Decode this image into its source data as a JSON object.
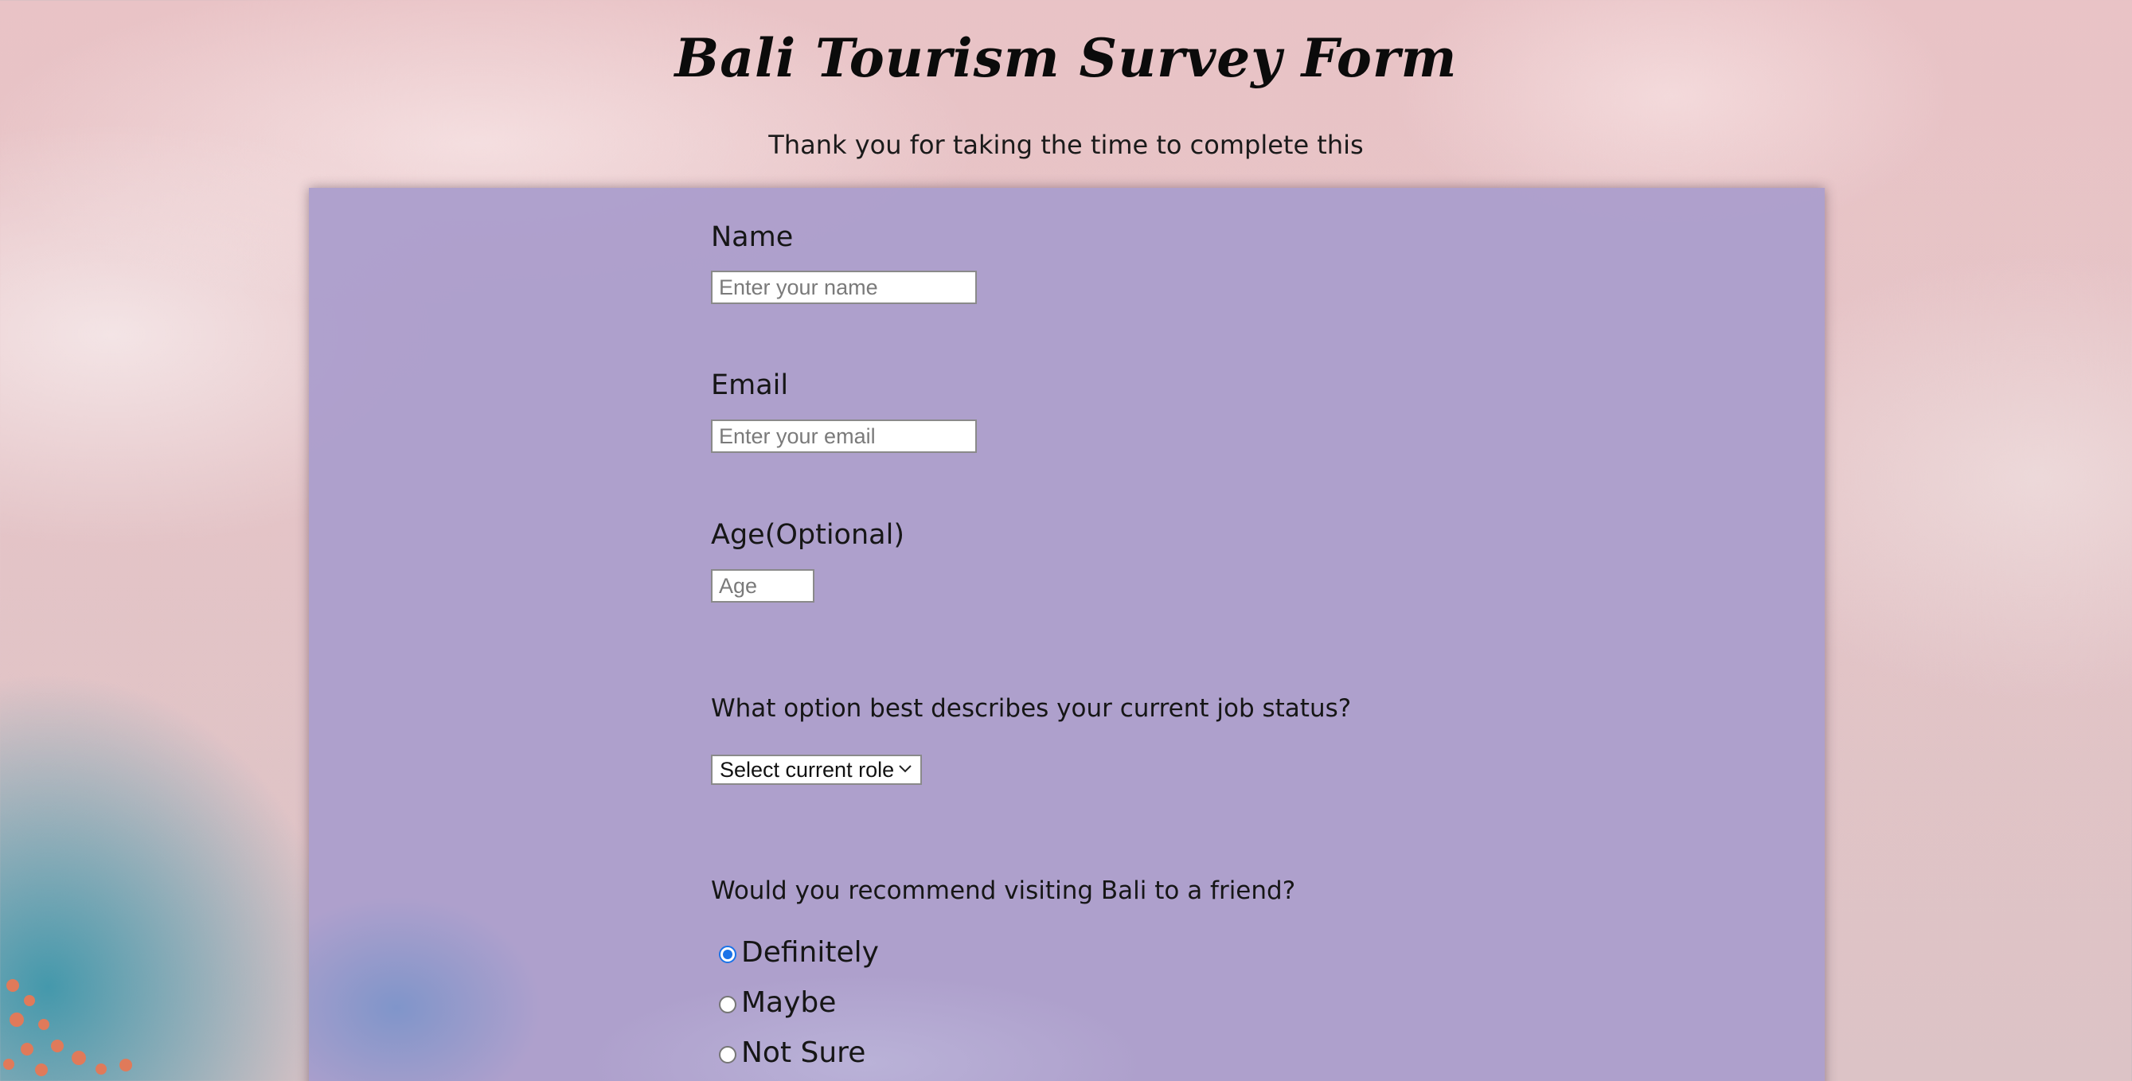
{
  "header": {
    "title": "Bali Tourism Survey Form",
    "subtitle": "Thank you for taking the time to complete this"
  },
  "form": {
    "name": {
      "label": "Name",
      "placeholder": "Enter your name",
      "value": ""
    },
    "email": {
      "label": "Email",
      "placeholder": "Enter your email",
      "value": ""
    },
    "age": {
      "label": "Age(Optional)",
      "placeholder": "Age",
      "value": ""
    },
    "job_status": {
      "question": "What option best describes your current job status?",
      "selected": "Select current role"
    },
    "recommend": {
      "question": "Would you recommend visiting Bali to a friend?",
      "options": [
        "Definitely",
        "Maybe",
        "Not Sure"
      ],
      "checked_index": 0
    }
  },
  "colors": {
    "card_background": "#ac9ecc",
    "page_background": "#e9c3c6",
    "radio_accent": "#1a73e8"
  }
}
